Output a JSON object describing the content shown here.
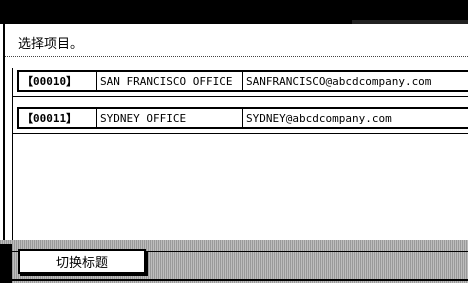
{
  "prompt": "选择项目。",
  "entries": [
    {
      "id": "【00010】",
      "name": "SAN FRANCISCO OFFICE",
      "email": "SANFRANCISCO@abcdcompany.com"
    },
    {
      "id": "【00011】",
      "name": "SYDNEY OFFICE",
      "email": "SYDNEY@abcdcompany.com"
    }
  ],
  "buttons": {
    "switch_title": "切换标题"
  }
}
